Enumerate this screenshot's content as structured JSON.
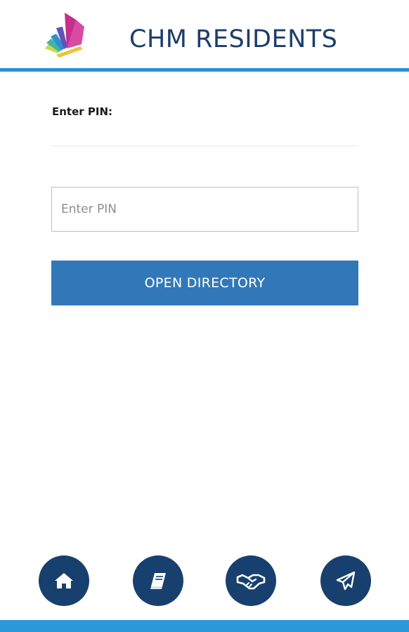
{
  "header": {
    "title": "CHM RESIDENTS",
    "logo_icon": "open-book-fan-logo",
    "rule_color": "#2a8fd4"
  },
  "form": {
    "label": "Enter PIN:",
    "pin_input": {
      "value": "",
      "placeholder": "Enter PIN"
    },
    "submit_label": "OPEN DIRECTORY",
    "submit_color": "#3278b8"
  },
  "bottom_nav": {
    "button_color": "#17406e",
    "items": [
      {
        "icon": "home-icon"
      },
      {
        "icon": "book-icon"
      },
      {
        "icon": "handshake-icon"
      },
      {
        "icon": "paper-plane-icon"
      }
    ]
  },
  "footer": {
    "bar_color": "#2a97d8"
  }
}
